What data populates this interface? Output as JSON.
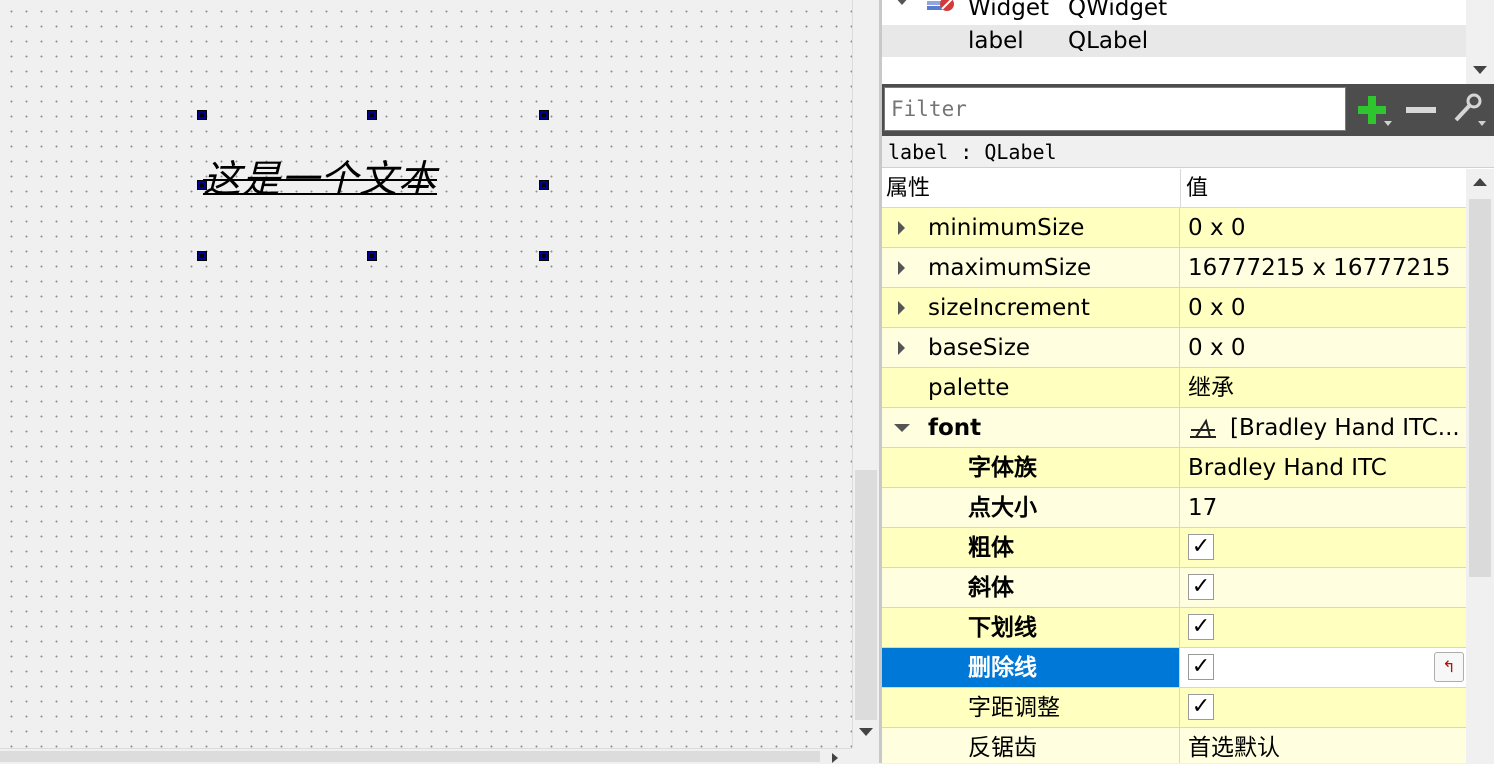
{
  "canvas": {
    "label_text": "这是一个文本"
  },
  "object_tree": {
    "rows": [
      {
        "object": "Widget",
        "class": "QWidget"
      },
      {
        "object": "label",
        "class": "QLabel"
      }
    ]
  },
  "filter": {
    "placeholder": "Filter"
  },
  "object_class_label": "label : QLabel",
  "properties": {
    "header": {
      "name": "属性",
      "value": "值"
    },
    "rows": [
      {
        "name": "minimumSize",
        "value": "0 x 0"
      },
      {
        "name": "maximumSize",
        "value": "16777215 x 16777215"
      },
      {
        "name": "sizeIncrement",
        "value": "0 x 0"
      },
      {
        "name": "baseSize",
        "value": "0 x 0"
      },
      {
        "name": "palette",
        "value": "继承"
      },
      {
        "name": "font",
        "value": "[Bradley Hand ITC..."
      },
      {
        "name": "字体族",
        "value": "Bradley Hand ITC"
      },
      {
        "name": "点大小",
        "value": "17"
      },
      {
        "name": "粗体",
        "value": "✓"
      },
      {
        "name": "斜体",
        "value": "✓"
      },
      {
        "name": "下划线",
        "value": "✓"
      },
      {
        "name": "删除线",
        "value": "✓"
      },
      {
        "name": "字距调整",
        "value": "✓"
      },
      {
        "name": "反锯齿",
        "value": "首选默认"
      }
    ]
  },
  "icons": {
    "widget_icon": "widget-icon",
    "add": "plus-icon",
    "remove": "minus-icon",
    "configure": "wrench-icon",
    "font": "font-icon",
    "reset": "reset-arrow-icon"
  },
  "colors": {
    "selection": "#0078d7",
    "row_odd": "#ffffbf",
    "row_even": "#ffffe0",
    "handle": "#00008b"
  }
}
